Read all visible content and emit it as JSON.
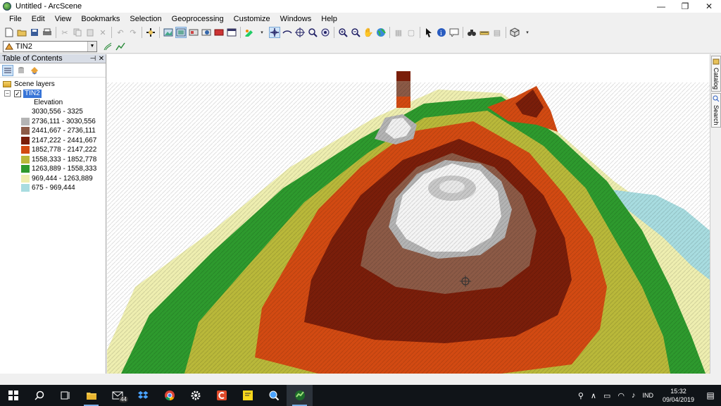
{
  "window": {
    "title": "Untitled - ArcScene",
    "minimize": "—",
    "maximize": "❐",
    "close": "✕"
  },
  "menu": [
    "File",
    "Edit",
    "View",
    "Bookmarks",
    "Selection",
    "Geoprocessing",
    "Customize",
    "Windows",
    "Help"
  ],
  "layer_selector": {
    "value": "TIN2"
  },
  "toc": {
    "title": "Table of Contents",
    "pin": "⊣",
    "close": "✕",
    "root_label": "Scene layers",
    "layer_name": "TIN2",
    "checked": "✓",
    "expander": "−",
    "field_label": "Elevation",
    "legend": [
      {
        "label": "3030,556 - 3325",
        "color": "#ffffff"
      },
      {
        "label": "2736,111 - 3030,556",
        "color": "#b4b4b4"
      },
      {
        "label": "2441,667 - 2736,111",
        "color": "#8c5a46"
      },
      {
        "label": "2147,222 - 2441,667",
        "color": "#7a1e0a"
      },
      {
        "label": "1852,778 - 2147,222",
        "color": "#d24a12"
      },
      {
        "label": "1558,333 - 1852,778",
        "color": "#b9b83a"
      },
      {
        "label": "1263,889 - 1558,333",
        "color": "#2e9a2e"
      },
      {
        "label": "969,444 - 1263,889",
        "color": "#eeeeb0"
      },
      {
        "label": "675 - 969,444",
        "color": "#a8dce0"
      }
    ]
  },
  "dock": {
    "catalog": "Catalog",
    "search": "Search"
  },
  "taskbar": {
    "mail_badge": "44",
    "lang": "IND",
    "time": "15:32",
    "date": "09/04/2019"
  }
}
